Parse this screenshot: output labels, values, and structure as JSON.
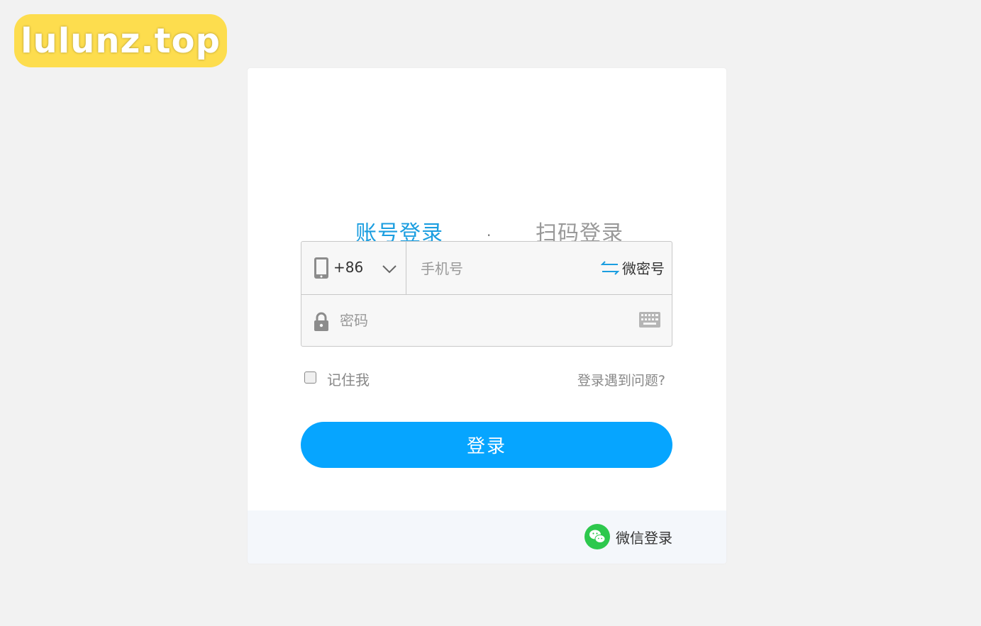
{
  "watermark": {
    "text": "lulunz.top"
  },
  "tabs": {
    "account": "账号登录",
    "separator": "·",
    "qrcode": "扫码登录"
  },
  "form": {
    "country_code": "+86",
    "phone_placeholder": "手机号",
    "switch_label": "微密号",
    "password_placeholder": "密码"
  },
  "options": {
    "remember_label": "记住我",
    "problem_link": "登录遇到问题?"
  },
  "login_button": "登录",
  "footer": {
    "wechat_label": "微信登录"
  },
  "colors": {
    "accent": "#1b9ee0",
    "button": "#06a5ff",
    "wechat": "#2dc84d",
    "watermark_bg": "#fddd4e"
  }
}
